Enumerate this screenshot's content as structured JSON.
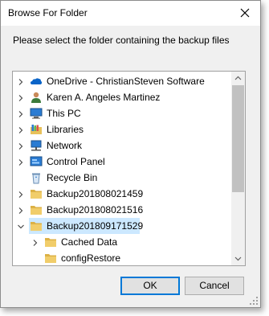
{
  "dialog": {
    "title": "Browse For Folder",
    "close_glyph": "✕",
    "instruction": "Please select the folder containing the backup files"
  },
  "tree": {
    "items": [
      {
        "label": "OneDrive - ChristianSteven Software",
        "icon": "onedrive-icon",
        "expander": "right",
        "depth": 0
      },
      {
        "label": "Karen A. Angeles Martinez",
        "icon": "user-icon",
        "expander": "right",
        "depth": 0
      },
      {
        "label": "This PC",
        "icon": "computer-icon",
        "expander": "right",
        "depth": 0
      },
      {
        "label": "Libraries",
        "icon": "libraries-icon",
        "expander": "right",
        "depth": 0
      },
      {
        "label": "Network",
        "icon": "network-icon",
        "expander": "right",
        "depth": 0
      },
      {
        "label": "Control Panel",
        "icon": "control-panel-icon",
        "expander": "right",
        "depth": 0
      },
      {
        "label": "Recycle Bin",
        "icon": "recycle-bin-icon",
        "expander": "none",
        "depth": 0
      },
      {
        "label": "Backup201808021459",
        "icon": "folder-icon",
        "expander": "right",
        "depth": 0
      },
      {
        "label": "Backup201808021516",
        "icon": "folder-icon",
        "expander": "right",
        "depth": 0
      },
      {
        "label": "Backup201809171529",
        "icon": "folder-icon",
        "expander": "down",
        "depth": 0,
        "selected": true
      },
      {
        "label": "Cached Data",
        "icon": "folder-icon",
        "expander": "right",
        "depth": 1
      },
      {
        "label": "configRestore",
        "icon": "folder-icon",
        "expander": "none",
        "depth": 1
      }
    ]
  },
  "buttons": {
    "ok": "OK",
    "cancel": "Cancel"
  },
  "colors": {
    "selection": "#cce8ff",
    "folder": "#e8c15a",
    "accent": "#0078d7"
  }
}
